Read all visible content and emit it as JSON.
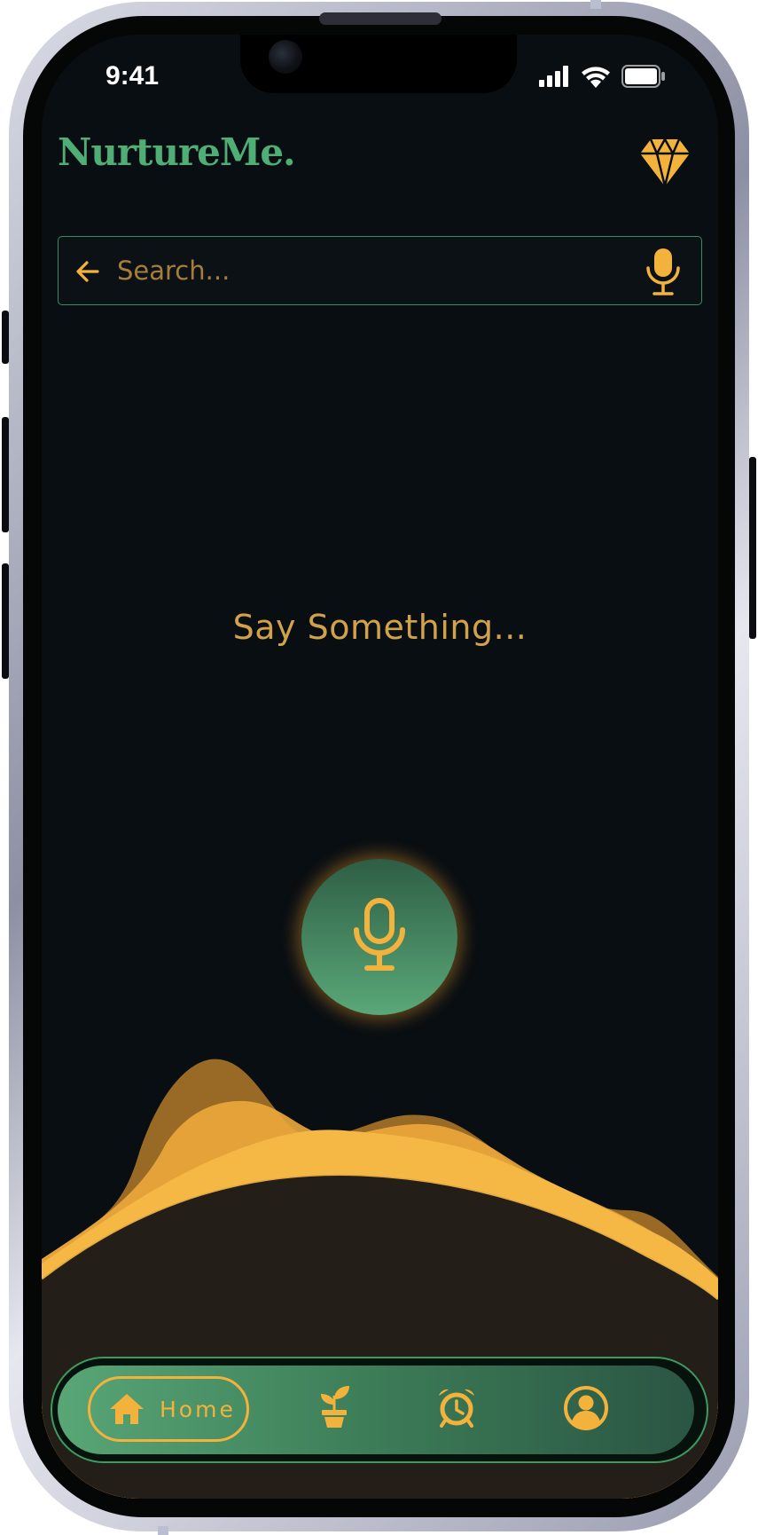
{
  "status_bar": {
    "time": "9:41"
  },
  "header": {
    "app_name": "NurtureMe."
  },
  "search": {
    "placeholder": "Search..."
  },
  "main": {
    "prompt": "Say Something..."
  },
  "bottom_nav": {
    "items": [
      {
        "label": "Home",
        "icon": "home-icon",
        "active": true
      },
      {
        "label": "",
        "icon": "plant-icon",
        "active": false
      },
      {
        "label": "",
        "icon": "alarm-clock-icon",
        "active": false
      },
      {
        "label": "",
        "icon": "profile-icon",
        "active": false
      }
    ]
  },
  "colors": {
    "accent": "#f3b23b",
    "brand_green": "#4fae76",
    "background": "#090e12",
    "prompt_text": "#d2a24a"
  }
}
